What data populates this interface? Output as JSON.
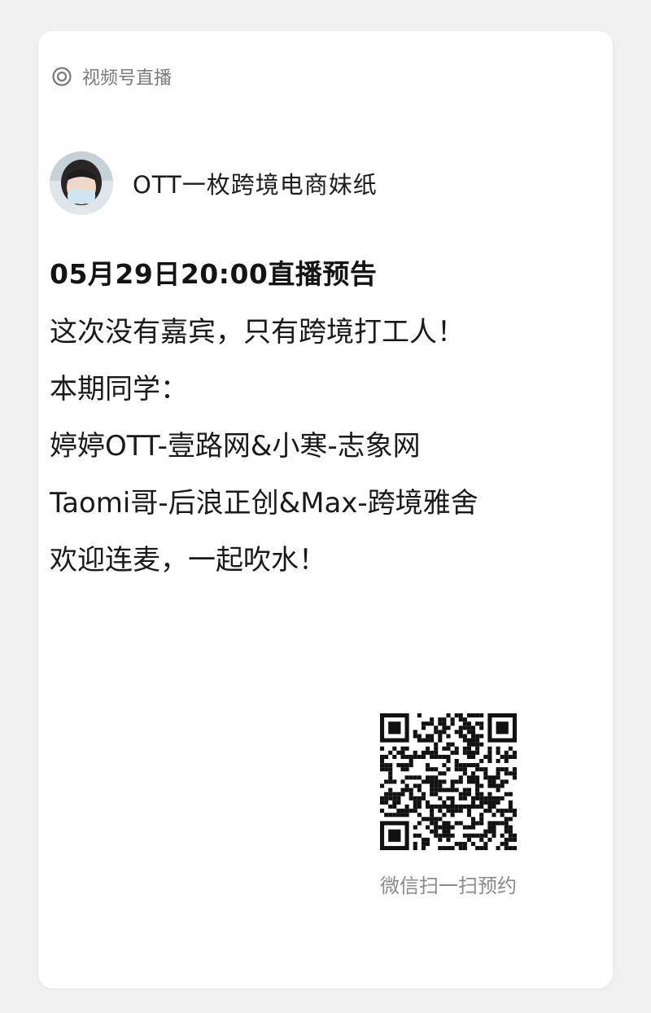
{
  "header": {
    "source_label": "视频号直播",
    "source_icon": "live-target-icon"
  },
  "author": {
    "name": "OTT一枚跨境电商妹纸"
  },
  "event": {
    "title": "05月29日20:00直播预告",
    "lines": [
      "这次没有嘉宾，只有跨境打工人！",
      "本期同学：",
      "婷婷OTT-壹路网&小寒-志象网",
      "Taomi哥-后浪正创&Max-跨境雅舍",
      "欢迎连麦，一起吹水！"
    ]
  },
  "qr": {
    "caption": "微信扫一扫预约"
  },
  "colors": {
    "background": "#f0f0f1",
    "card": "#ffffff",
    "text": "#1a1a1a",
    "muted": "#7a7a7a"
  }
}
